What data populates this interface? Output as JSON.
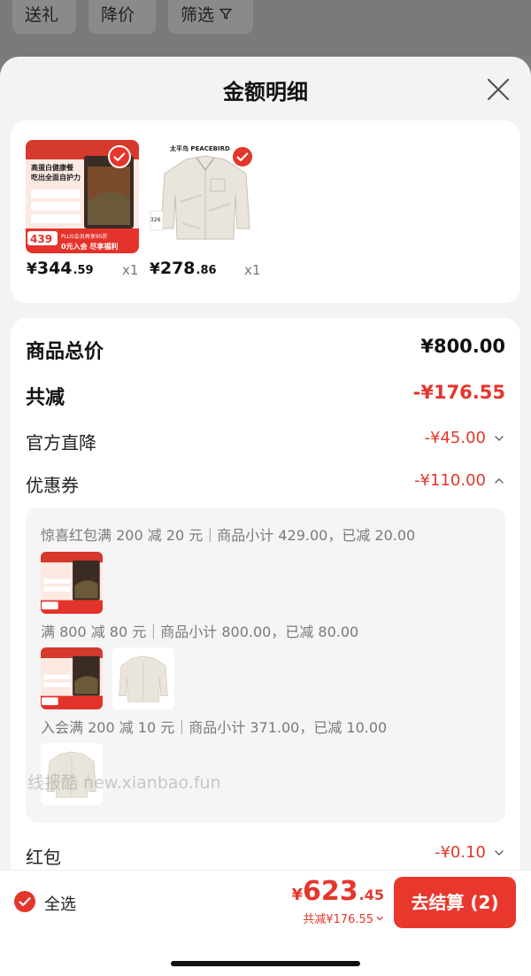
{
  "filter_bar": {
    "chips": [
      "送礼",
      "降价",
      "筛选"
    ]
  },
  "sheet": {
    "title": "金额明细"
  },
  "products": [
    {
      "price_currency": "¥",
      "price_int": "344",
      "price_dec": ".59",
      "qty": "x1",
      "selected": true,
      "image_text": {
        "banner": "高蛋白健康餐",
        "banner2": "吃出全面自护力",
        "badge_price": "439",
        "promo": "PLUS会员再享95折",
        "promo2": "0元入会 尽享福利"
      }
    },
    {
      "price_currency": "¥",
      "price_int": "278",
      "price_dec": ".86",
      "qty": "x1",
      "selected": true,
      "image_text": {
        "brand": "太平鸟 PEACEBIRD",
        "tag": "326"
      }
    }
  ],
  "summary": {
    "total_label": "商品总价",
    "total_value": "¥800.00",
    "minus_label": "共减",
    "minus_value": "-¥176.55",
    "direct_label": "官方直降",
    "direct_value": "-¥45.00",
    "coupon_label": "优惠券",
    "coupon_value": "-¥110.00",
    "hongbao_label": "红包",
    "hongbao_value": "-¥0.10"
  },
  "coupons": [
    "惊喜红包满 200 减 20 元｜商品小计 429.00，已减 20.00",
    "满 800 减 80 元｜商品小计 800.00，已减 80.00",
    "入会满 200 减 10 元｜商品小计 371.00，已减 10.00"
  ],
  "watermark": "线报酷 new.xianbao.fun",
  "bottom_bar": {
    "select_all": "全选",
    "pay_currency": "¥",
    "pay_int": "623",
    "pay_dec": ".45",
    "pay_sub": "共减¥176.55",
    "checkout_label": "去结算 (2)"
  },
  "colors": {
    "accent": "#e5362c",
    "checkout_bg": "#e8372d",
    "sheet_bg": "#f3f3f3",
    "card_bg": "#ffffff",
    "muted_text": "#7a7a7a"
  },
  "icons": {
    "close": "close-icon",
    "check": "check-icon",
    "filter": "funnel-icon",
    "chevron_down": "chevron-down-icon",
    "chevron_up": "chevron-up-icon"
  }
}
